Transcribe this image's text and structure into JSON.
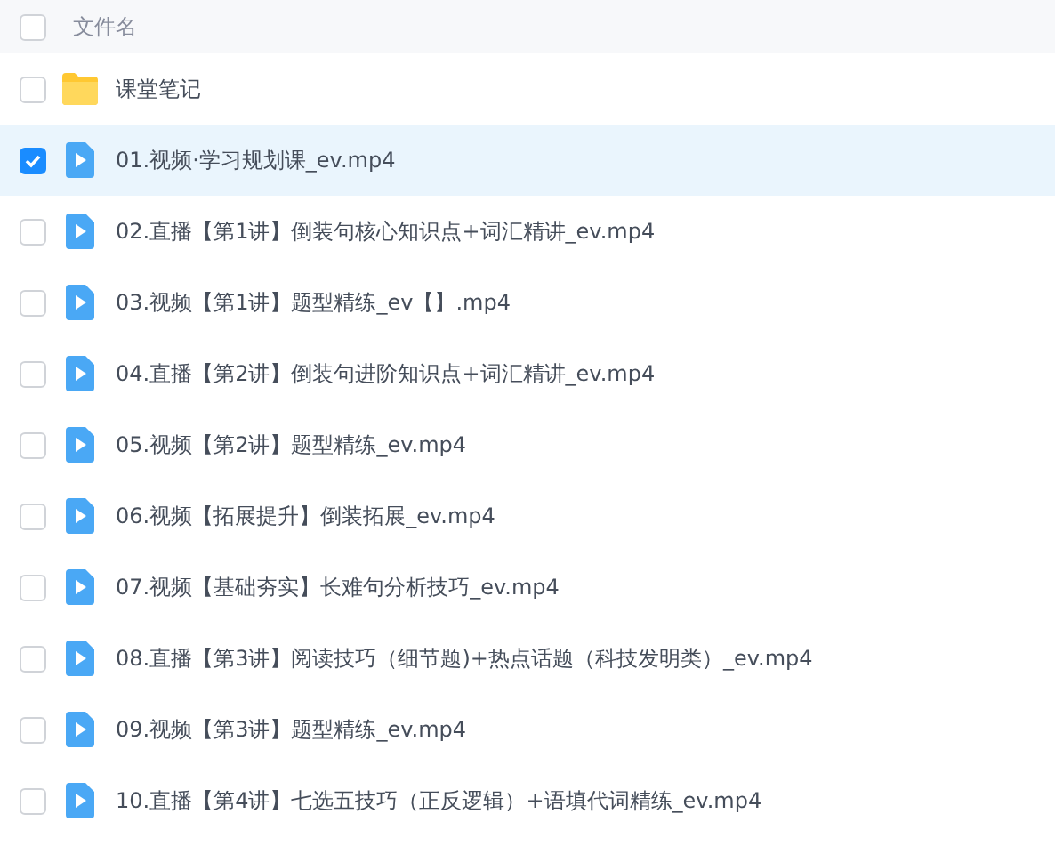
{
  "header": {
    "checked": false,
    "column_label": "文件名"
  },
  "files": [
    {
      "kind": "folder",
      "name": "课堂笔记",
      "checked": false
    },
    {
      "kind": "video",
      "name": "01.视频·学习规划课_ev.mp4",
      "checked": true
    },
    {
      "kind": "video",
      "name": "02.直播【第1讲】倒装句核心知识点+词汇精讲_ev.mp4",
      "checked": false
    },
    {
      "kind": "video",
      "name": "03.视频【第1讲】题型精练_ev【】.mp4",
      "checked": false
    },
    {
      "kind": "video",
      "name": "04.直播【第2讲】倒装句进阶知识点+词汇精讲_ev.mp4",
      "checked": false
    },
    {
      "kind": "video",
      "name": "05.视频【第2讲】题型精练_ev.mp4",
      "checked": false
    },
    {
      "kind": "video",
      "name": "06.视频【拓展提升】倒装拓展_ev.mp4",
      "checked": false
    },
    {
      "kind": "video",
      "name": "07.视频【基础夯实】长难句分析技巧_ev.mp4",
      "checked": false
    },
    {
      "kind": "video",
      "name": "08.直播【第3讲】阅读技巧（细节题)+热点话题（科技发明类）_ev.mp4",
      "checked": false
    },
    {
      "kind": "video",
      "name": "09.视频【第3讲】题型精练_ev.mp4",
      "checked": false
    },
    {
      "kind": "video",
      "name": "10.直播【第4讲】七选五技巧（正反逻辑）+语填代词精练_ev.mp4",
      "checked": false
    }
  ]
}
